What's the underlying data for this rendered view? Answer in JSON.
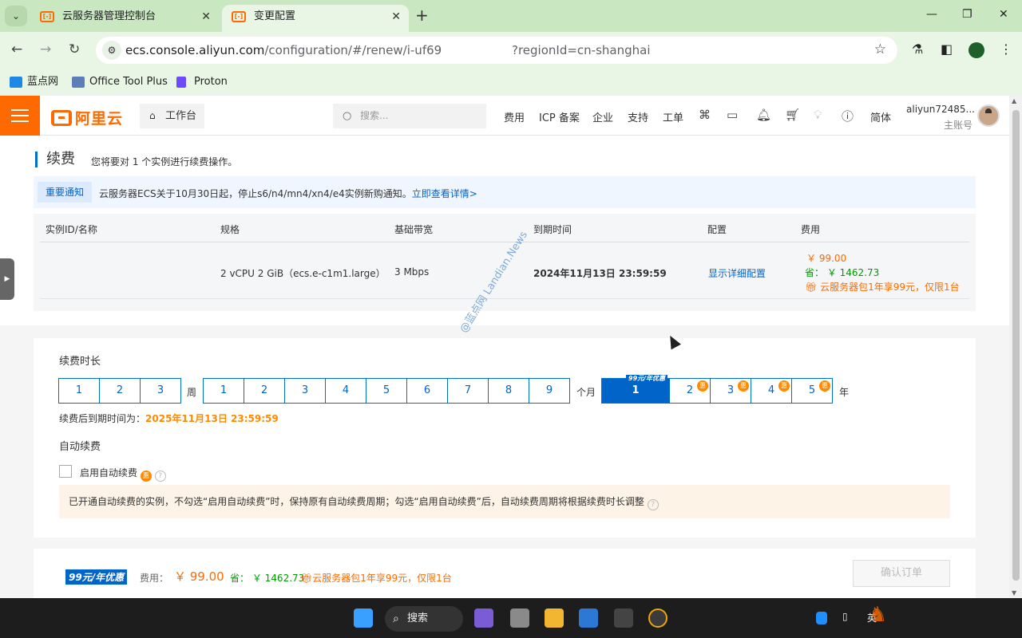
{
  "browser": {
    "tabs": [
      {
        "title": "云服务器管理控制台"
      },
      {
        "title": "变更配置"
      }
    ],
    "url_main": "ecs.console.aliyun.com",
    "url_path": "/configuration/#/renew/i-uf69",
    "url_query": "?regionId=cn-shanghai",
    "bookmarks": [
      {
        "label": "蓝点网"
      },
      {
        "label": "Office Tool Plus"
      },
      {
        "label": "Proton"
      }
    ]
  },
  "console": {
    "logo": "阿里云",
    "workbench": "工作台",
    "search_placeholder": "搜索...",
    "nav": [
      "费用",
      "ICP 备案",
      "企业",
      "支持",
      "工单",
      "简体"
    ],
    "user_name": "aliyun72485...",
    "user_role": "主账号"
  },
  "renew": {
    "title": "续费",
    "desc": "您将要对 1 个实例进行续费操作。",
    "notice_tag": "重要通知",
    "notice_text": "云服务器ECS关于10月30日起，停止s6/n4/mn4/xn4/e4实例新购通知。",
    "notice_link": "立即查看详情>",
    "table": {
      "headers": [
        "实例ID/名称",
        "规格",
        "基础带宽",
        "到期时间",
        "配置",
        "费用"
      ],
      "spec": "2 vCPU 2 GiB（ecs.e-c1m1.large）",
      "bandwidth": "3 Mbps",
      "expire": "2024年11月13日 23:59:59",
      "config_link": "显示详细配置",
      "fee_price": "￥ 99.00",
      "fee_save": "省：  ￥ 1462.73",
      "fee_pkg": "云服务器包1年享99元，仅限1台"
    }
  },
  "duration": {
    "label": "续费时长",
    "weeks": [
      "1",
      "2",
      "3"
    ],
    "week_unit": "周",
    "months": [
      "1",
      "2",
      "3",
      "4",
      "5",
      "6",
      "7",
      "8",
      "9"
    ],
    "month_unit": "个月",
    "years": [
      "1",
      "2",
      "3",
      "4",
      "5"
    ],
    "year_unit": "年",
    "year_badge": "99元/年优惠",
    "discount_mark": "惠",
    "selected": "1年",
    "expire_label": "续费后到期时间为：",
    "expire_value": "2025年11月13日 23:59:59",
    "auto_label": "自动续费",
    "auto_checkbox": "启用自动续费",
    "auto_checked": false,
    "hint": "已开通自动续费的实例，不勾选“启用自动续费”时，保持原有自动续费周期；勾选“启用自动续费”后，自动续费周期将根据续费时长调整"
  },
  "footer_bar": {
    "promo": "99元/年优惠",
    "fee_label": "费用：",
    "fee_value": "￥ 99.00",
    "save_label": "省：",
    "save_value": "￥ 1462.73",
    "pkg": "云服务器包1年享99元，仅限1台",
    "confirm": "确认订单"
  },
  "watermark": "@蓝点网 Landian.News",
  "taskbar": {
    "search": "搜索",
    "ime": "英"
  },
  "colors": {
    "brand": "#ff6a00",
    "link": "#0064c8",
    "save": "#009a00",
    "browser_frame": "#c9e7c0"
  }
}
